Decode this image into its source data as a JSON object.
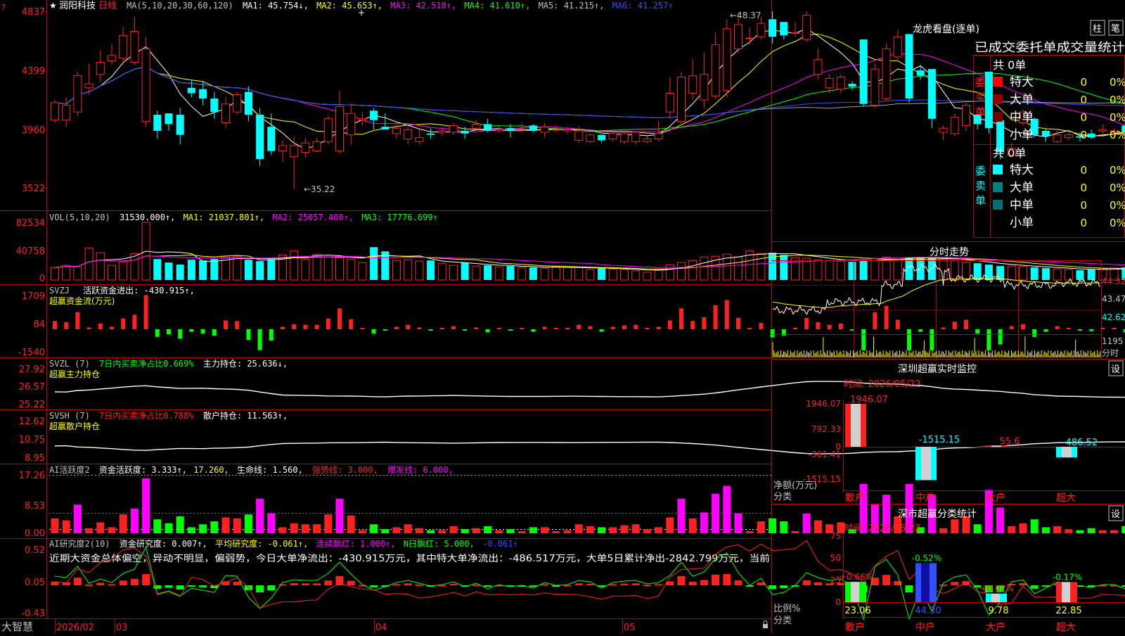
{
  "stock": {
    "name": "润阳科技",
    "period": "日线",
    "star": "★",
    "corner_mark": "?"
  },
  "colors": {
    "up": "#ff2020",
    "down": "#00ffff",
    "grid": "#c00000",
    "white": "#ffffff",
    "yellow": "#ffff00",
    "magenta": "#ff00ff",
    "green": "#00ff00",
    "blue": "#3050ff",
    "gray": "#a0a0a0"
  },
  "main_chart": {
    "legend": [
      {
        "text": "MA(5,10,20,30,60,120)",
        "color": "#c0c0c0"
      },
      {
        "text": "MA1: 45.754↓,",
        "color": "#ffffff"
      },
      {
        "text": "MA2: 45.653↑,",
        "color": "#ffff00"
      },
      {
        "text": "MA3: 42.518↑,",
        "color": "#ff00ff"
      },
      {
        "text": "MA4: 41.610↑,",
        "color": "#00ff00"
      },
      {
        "text": "MA5: 41.215↑,",
        "color": "#c0c0c0"
      },
      {
        "text": "MA6: 41.257↑",
        "color": "#3050ff"
      }
    ],
    "y_ticks": [
      "4837",
      "4399",
      "3960",
      "3522"
    ],
    "high_label": "←48.37",
    "low_label": "←35.22",
    "ylim": [
      35.0,
      48.5
    ]
  },
  "chart_data": {
    "type": "candlestick",
    "open": [
      40.3,
      40.3,
      40.9,
      42.7,
      43.7,
      44.7,
      44.9,
      44.6,
      40.2,
      40.7,
      40.8,
      40.7,
      42.7,
      42.6,
      41.9,
      40.1,
      40.9,
      42.4,
      40.7,
      39.8,
      38.0,
      37.6,
      37.9,
      38.0,
      38.7,
      38.0,
      39.2,
      40.3,
      41.0,
      39.8,
      39.3,
      38.9,
      38.7,
      39.3,
      39.4,
      39.4,
      39.5,
      39.7,
      40.0,
      39.5,
      39.7,
      39.6,
      39.9,
      39.4,
      39.6,
      39.5,
      38.8,
      38.7,
      39.2,
      38.9,
      38.7,
      38.7,
      38.7,
      38.9,
      40.9,
      40.2,
      42.3,
      41.8,
      42.1,
      42.5,
      45.6,
      46.4,
      46.5,
      47.8,
      47.6,
      46.8,
      46.3,
      43.7,
      42.7,
      42.6,
      43.0,
      46.3,
      41.4,
      41.9,
      45.0,
      46.7,
      44.0,
      44.1,
      39.4,
      39.3,
      39.9,
      40.7,
      43.9,
      40.3,
      37.7,
      40.1,
      40.4,
      39.5,
      38.7,
      39.0,
      39.1,
      39.3,
      39.5,
      39.4,
      39.9,
      39.5,
      39.6,
      39.4,
      39.4,
      39.5,
      39.7,
      39.6,
      39.3,
      39.6,
      39.4,
      39.7,
      39.5,
      39.3,
      40.1,
      40.2
    ],
    "close": [
      41.6,
      41.4,
      43.6,
      43.0,
      44.6,
      45.1,
      46.6,
      46.9,
      45.6,
      39.5,
      40.0,
      39.2,
      42.3,
      41.9,
      40.9,
      41.5,
      42.2,
      40.7,
      37.4,
      38.0,
      38.4,
      38.4,
      38.6,
      38.7,
      40.4,
      41.3,
      40.8,
      40.4,
      40.3,
      39.6,
      39.7,
      39.6,
      39.0,
      39.2,
      39.5,
      39.9,
      39.3,
      40.0,
      39.5,
      39.6,
      39.5,
      39.6,
      39.5,
      39.8,
      39.6,
      39.6,
      39.5,
      39.2,
      38.8,
      39.3,
      39.3,
      39.4,
      38.9,
      39.3,
      42.3,
      43.5,
      43.6,
      43.7,
      45.9,
      47.1,
      47.4,
      46.4,
      47.5,
      46.5,
      46.6,
      46.8,
      48.1,
      44.8,
      43.4,
      43.5,
      42.8,
      41.5,
      44.1,
      45.6,
      46.5,
      41.9,
      43.6,
      40.4,
      39.7,
      40.5,
      41.4,
      40.0,
      39.7,
      37.9,
      38.2,
      40.9,
      39.2,
      39.1,
      39.2,
      39.2,
      39.0,
      39.0,
      39.6,
      39.5,
      39.4,
      39.9,
      39.9,
      39.3,
      39.2,
      39.6,
      39.9,
      39.1,
      39.5,
      39.5,
      39.7,
      39.7,
      39.3,
      39.6,
      40.4,
      40.7
    ],
    "high": [
      41.8,
      42.0,
      43.9,
      44.5,
      45.5,
      46.0,
      47.2,
      48.0,
      46.5,
      41.0,
      40.4,
      41.2,
      43.3,
      43.2,
      42.4,
      42.0,
      42.4,
      42.8,
      41.2,
      40.8,
      38.8,
      39.1,
      39.0,
      39.0,
      40.6,
      42.5,
      41.5,
      40.9,
      41.2,
      40.8,
      40.0,
      39.8,
      39.6,
      39.7,
      39.8,
      40.1,
      39.8,
      40.3,
      40.4,
      39.8,
      40.0,
      40.1,
      40.0,
      40.1,
      39.9,
      39.8,
      39.8,
      39.3,
      39.2,
      39.4,
      39.5,
      39.4,
      39.1,
      40.2,
      43.5,
      43.9,
      44.8,
      45.3,
      46.8,
      47.8,
      48.3,
      47.2,
      48.0,
      48.4,
      47.5,
      47.6,
      48.4,
      45.6,
      43.7,
      43.7,
      43.2,
      41.8,
      44.5,
      46.0,
      47.0,
      43.2,
      44.4,
      41.2,
      39.9,
      40.8,
      41.6,
      40.6,
      40.2,
      40.5,
      38.6,
      41.1,
      40.5,
      39.7,
      39.5,
      39.4,
      39.4,
      39.6,
      40.0,
      39.7,
      40.1,
      40.1,
      40.2,
      39.9,
      39.6,
      39.8,
      40.1,
      39.8,
      39.8,
      39.9,
      39.8,
      39.8,
      39.6,
      40.1,
      40.5,
      40.9
    ],
    "low": [
      40.1,
      39.8,
      40.6,
      42.2,
      43.1,
      44.4,
      44.4,
      44.4,
      39.8,
      38.9,
      39.5,
      38.5,
      42.0,
      41.4,
      40.4,
      39.7,
      40.7,
      40.2,
      36.9,
      37.7,
      37.2,
      35.2,
      37.5,
      37.9,
      38.5,
      37.8,
      38.5,
      39.9,
      39.6,
      39.6,
      38.9,
      38.5,
      38.5,
      38.9,
      39.1,
      39.2,
      38.9,
      39.5,
      39.4,
      39.4,
      39.0,
      39.4,
      39.4,
      39.0,
      39.4,
      39.3,
      38.6,
      38.6,
      38.6,
      38.7,
      38.5,
      38.5,
      38.6,
      38.7,
      40.4,
      39.9,
      41.8,
      41.2,
      41.9,
      42.0,
      45.3,
      45.9,
      46.3,
      46.0,
      46.3,
      46.5,
      46.1,
      43.3,
      42.3,
      42.3,
      42.5,
      41.3,
      41.2,
      41.7,
      44.8,
      41.6,
      43.3,
      39.7,
      38.8,
      39.1,
      39.5,
      39.6,
      39.3,
      37.4,
      37.6,
      39.9,
      39.0,
      38.7,
      38.6,
      38.8,
      38.7,
      38.9,
      39.3,
      39.1,
      39.3,
      39.4,
      39.3,
      39.0,
      39.2,
      39.3,
      39.5,
      39.0,
      39.3,
      39.4,
      39.3,
      39.4,
      39.2,
      39.1,
      39.6,
      39.9
    ]
  },
  "volume_panel": {
    "legend": [
      {
        "text": "VOL(5,10,20)",
        "color": "#c0c0c0"
      },
      {
        "text": "31530.000↑,",
        "color": "#ffffff"
      },
      {
        "text": "MA1: 21037.801↑,",
        "color": "#ffff00"
      },
      {
        "text": "MA2: 25057.400↑,",
        "color": "#ff00ff"
      },
      {
        "text": "MA3: 17776.699↑",
        "color": "#00ff00"
      }
    ],
    "y_ticks": [
      "82534",
      "40758",
      "0"
    ],
    "values": [
      18000,
      21000,
      19000,
      46000,
      39000,
      21000,
      26000,
      38000,
      82534,
      30000,
      25000,
      22000,
      29000,
      28000,
      30000,
      33000,
      34000,
      29000,
      27000,
      30000,
      36000,
      42000,
      30000,
      37000,
      33000,
      32000,
      30000,
      25000,
      47000,
      41000,
      28000,
      29000,
      27000,
      28000,
      24000,
      21000,
      25000,
      20000,
      21000,
      19000,
      20000,
      18000,
      18000,
      17000,
      19000,
      18000,
      18000,
      15000,
      17000,
      16000,
      15000,
      13000,
      11000,
      15000,
      22000,
      25000,
      28000,
      33000,
      34000,
      37000,
      33000,
      42000,
      38000,
      39000,
      36000,
      32000,
      31000,
      29000,
      28000,
      27000,
      26000,
      28000,
      31000,
      33000,
      30000,
      32000,
      33000,
      31530,
      30000,
      28000,
      25000,
      24000,
      22000,
      20000,
      20000,
      19000,
      18000,
      17000,
      16000,
      15000,
      14000,
      15000,
      16000,
      17000,
      18000,
      19000,
      17000,
      16000,
      15000,
      14000,
      13000,
      15000,
      16000,
      17000,
      18000,
      19000,
      20000,
      21000,
      22000,
      31530
    ]
  },
  "svzj_panel": {
    "legend1": "SVZJ",
    "legend2": "活跃资金进出: -430.915↑,",
    "subtitle": "超赢资金流(万元)",
    "y_ticks": [
      "1709",
      "84",
      "-1540"
    ]
  },
  "svzl_panel": {
    "legend1": "SVZL (7)",
    "legend2": "7日内买卖净占比0.669%",
    "legend3": "主力持仓: 25.636↓,",
    "subtitle": "超赢主力持仓",
    "y_ticks": [
      "27.92",
      "26.57",
      "25.22"
    ]
  },
  "svsh_panel": {
    "legend1": "SVSH (7)",
    "legend2": "7日内买卖净占比0.788%",
    "legend3": "散户持仓: 11.563↑,",
    "subtitle": "超赢散户持仓",
    "y_ticks": [
      "12.62",
      "10.75",
      "8.95"
    ]
  },
  "ai_panel": {
    "legend": [
      {
        "text": "AI活跃度2",
        "color": "#c0c0c0"
      },
      {
        "text": "资金活跃度: 3.333↑,",
        "color": "#ffffff"
      },
      {
        "text": "17.260,",
        "color": "#ffff00"
      },
      {
        "text": "生命线: 1.560,",
        "color": "#ffffff"
      },
      {
        "text": "强势线: 3.000,",
        "color": "#ff2020"
      },
      {
        "text": "爆发线: 6.000,",
        "color": "#ff00ff"
      }
    ],
    "y_ticks": [
      "17.26",
      "8.53",
      "0.00"
    ]
  },
  "research_panel": {
    "legend": [
      {
        "text": "AI研究度2(10)",
        "color": "#c0c0c0"
      },
      {
        "text": "资金研究度: 0.007↑,",
        "color": "#ffffff"
      },
      {
        "text": "平均研究度: -0.061↑,",
        "color": "#ffff00"
      },
      {
        "text": "连续飘红: 1.000↑,",
        "color": "#ff00ff"
      },
      {
        "text": "N日飘红: 5.000,",
        "color": "#00ff00"
      },
      {
        "text": "-0.061↑",
        "color": "#3050ff"
      }
    ],
    "message": "近期大资金总体偏空，异动不明显，偏弱势，今日大单净流出：-430.915万元，其中特大单净流出：-486.517万元，大单5日累计净出-2842.799万元，当前",
    "y_ticks": [
      "0.52",
      "0.05",
      "-0.43"
    ]
  },
  "x_axis": {
    "labels": [
      "2026/02",
      "03",
      "04",
      "05"
    ],
    "brand": "大智慧",
    "lock_icon": "lock-icon"
  },
  "dragon": {
    "title": "龙虎看盘(逐单)",
    "btn_bar": "柱",
    "btn_stroke": "笔",
    "subtitle": "已成交委托单成交量统计",
    "buy_label": "委买单",
    "sell_label": "委卖单",
    "buy_total": "共 0单",
    "sell_total": "共 0单",
    "buy_rows": [
      {
        "name": "特大",
        "vol": "0",
        "pct": "0%",
        "swatch": "#ff0000"
      },
      {
        "name": "大单",
        "vol": "0",
        "pct": "0%",
        "swatch": "#900000"
      },
      {
        "name": "中单",
        "vol": "0",
        "pct": "0%",
        "swatch": "#700000"
      },
      {
        "name": "小单",
        "vol": "0",
        "pct": "0%",
        "swatch": ""
      }
    ],
    "sell_rows": [
      {
        "name": "特大",
        "vol": "0",
        "pct": "0%",
        "swatch": "#00ffff"
      },
      {
        "name": "大单",
        "vol": "0",
        "pct": "0%",
        "swatch": "#008080"
      },
      {
        "name": "中单",
        "vol": "0",
        "pct": "0%",
        "swatch": "#007070"
      },
      {
        "name": "小单",
        "vol": "0",
        "pct": "0%",
        "swatch": ""
      }
    ]
  },
  "intraday": {
    "title": "分时走势",
    "y_ticks": [
      "44.32",
      "43.47",
      "42.62"
    ],
    "vol_tick": "1195",
    "vol_label": "分时"
  },
  "sz_monitor": {
    "title": "深圳超赢实时监控",
    "settings_btn": "设",
    "time": "时间: 2026/05/22",
    "y_ticks": [
      "1946.07",
      "792.33",
      "0",
      "-361.41",
      "-1515.15"
    ],
    "y_label_line1": "净额(万元)",
    "y_label_line2": "分类",
    "bars": [
      {
        "cat": "散户",
        "value": 1946.07,
        "label": "1946.07"
      },
      {
        "cat": "中户",
        "value": -1515.15,
        "label": "-1515.15"
      },
      {
        "cat": "大户",
        "value": 55.6,
        "label": "55.6"
      },
      {
        "cat": "超大",
        "value": -486.52,
        "label": "-486.52"
      }
    ]
  },
  "sz_class": {
    "title": "深市超赢分类统计",
    "settings_btn": "设",
    "time": "时间: 2026/05/22",
    "y_ticks": [
      "75",
      "50",
      "25",
      "0"
    ],
    "y_label_line1": "比例%",
    "y_label_line2": "分类",
    "bars": [
      {
        "cat": "散户",
        "value": 23.06,
        "label": "23.06",
        "change": "+0.66%"
      },
      {
        "cat": "中户",
        "value": 44.3,
        "label": "44.30",
        "change": "-0.52%"
      },
      {
        "cat": "大户",
        "value": 9.78,
        "label": "9.78",
        "change": "+0.02%"
      },
      {
        "cat": "超大",
        "value": 22.85,
        "label": "22.85",
        "change": "-0.17%"
      }
    ]
  }
}
